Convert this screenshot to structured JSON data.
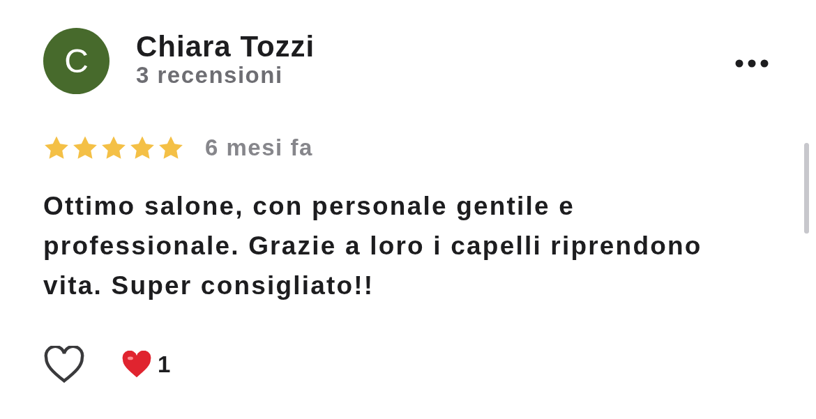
{
  "reviewer": {
    "initial": "C",
    "name": "Chiara Tozzi",
    "review_count": "3 recensioni"
  },
  "rating": {
    "stars": 5,
    "time": "6 mesi fa"
  },
  "text": "Ottimo salone, con personale gentile e professionale. Grazie a loro i capelli riprendono vita. Super consigliato!!",
  "reactions": {
    "liked": false,
    "heart_count": "1"
  }
}
